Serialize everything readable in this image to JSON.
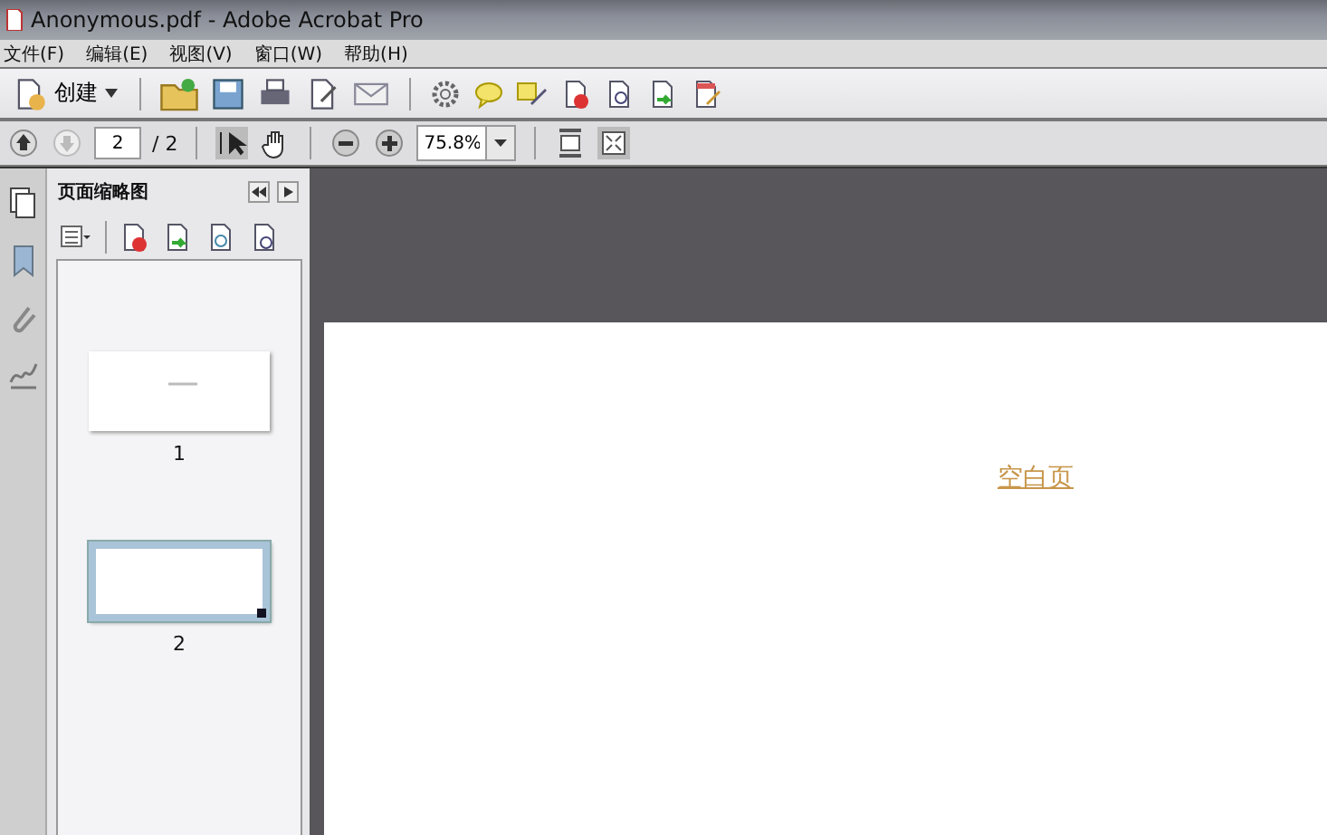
{
  "window": {
    "title": "Anonymous.pdf - Adobe Acrobat Pro"
  },
  "menu": [
    "文件(F)",
    "编辑(E)",
    "视图(V)",
    "窗口(W)",
    "帮助(H)"
  ],
  "toolbar": {
    "create_label": "创建"
  },
  "page_nav": {
    "current": "2",
    "total": "/ 2",
    "zoom": "75.8%"
  },
  "panel": {
    "title": "页面缩略图",
    "thumbnails": [
      {
        "number": "1",
        "selected": false,
        "blank": false
      },
      {
        "number": "2",
        "selected": true,
        "blank": true
      }
    ]
  },
  "document": {
    "text": "空白页"
  }
}
